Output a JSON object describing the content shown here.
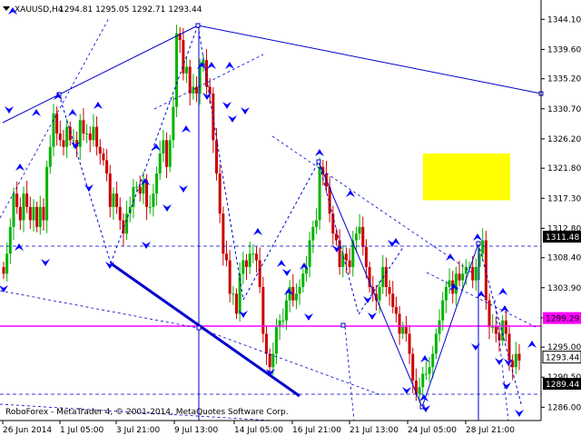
{
  "header": {
    "symbol": "XAUUSD,H4",
    "ohlc": "1294.81 1295.05 1292.71 1293.44"
  },
  "watermark": "RoboForex - MetaTrader 4, © 2001-2014, MetaQuotes Software Corp.",
  "colors": {
    "bull": "#00b400",
    "bear": "#cc0000",
    "trend": "#0000cc",
    "magenta": "#ff00ff",
    "zone": "#ffff00",
    "arrow": "#0000ff"
  },
  "icons": [
    "down-triangle-icon"
  ],
  "price_tags": [
    {
      "text": "1311.48",
      "price": 1311.48,
      "style": "dark"
    },
    {
      "text": "1299.29",
      "price": 1299.29,
      "style": "magenta"
    },
    {
      "text": "1293.44",
      "price": 1293.44,
      "style": "light"
    },
    {
      "text": "1289.44",
      "price": 1289.44,
      "style": "dark"
    }
  ],
  "chart_data": {
    "type": "candlestick",
    "symbol": "XAUUSD",
    "timeframe": "H4",
    "y_ticks": [
      "1344.10",
      "1339.60",
      "1335.20",
      "1330.70",
      "1326.20",
      "1321.80",
      "1317.30",
      "1312.80",
      "1308.40",
      "1303.90",
      "1299.40",
      "1295.00",
      "1290.50",
      "1286.00"
    ],
    "y_values": [
      1344.1,
      1339.6,
      1335.2,
      1330.7,
      1326.2,
      1321.8,
      1317.3,
      1312.8,
      1308.4,
      1303.9,
      1299.4,
      1295.0,
      1290.5,
      1286.0
    ],
    "x_ticks": [
      "26 Jun 2014",
      "1 Jul 05:00",
      "3 Jul 21:00",
      "9 Jul 13:00",
      "14 Jul 05:00",
      "16 Jul 21:00",
      "21 Jul 13:00",
      "24 Jul 05:00",
      "28 Jul 21:00"
    ],
    "ylim": [
      1284.0,
      1347.0
    ],
    "horizontal_levels": [
      1311.48,
      1299.29,
      1289.44
    ],
    "target_zone": [
      1317.0,
      1324.0
    ],
    "last_close": 1293.44,
    "close_path": [
      1306,
      1309,
      1313,
      1318,
      1316,
      1314,
      1318,
      1316,
      1314,
      1316,
      1313,
      1316,
      1314,
      1322,
      1325,
      1330,
      1327,
      1326,
      1325,
      1328,
      1326,
      1326,
      1325,
      1329,
      1327,
      1327,
      1326,
      1328,
      1325,
      1324,
      1323,
      1321,
      1316,
      1318,
      1316,
      1314,
      1312,
      1315,
      1316,
      1319,
      1319,
      1318,
      1320,
      1316,
      1316,
      1318,
      1321,
      1324,
      1326,
      1322,
      1326,
      1331,
      1342,
      1341,
      1336,
      1337,
      1333,
      1334,
      1333,
      1337,
      1338,
      1334,
      1333,
      1326,
      1321,
      1315,
      1309,
      1308,
      1303,
      1303,
      1300,
      1306,
      1308,
      1307,
      1309,
      1309,
      1308,
      1304,
      1297,
      1294,
      1292,
      1294,
      1298,
      1299,
      1299,
      1302,
      1304,
      1302,
      1303,
      1304,
      1306,
      1307,
      1311,
      1313,
      1314,
      1322,
      1321,
      1319,
      1315,
      1312,
      1311,
      1307,
      1309,
      1308,
      1307,
      1311,
      1312,
      1313,
      1310,
      1307,
      1304,
      1303,
      1302,
      1304,
      1307,
      1304,
      1303,
      1301,
      1300,
      1297,
      1298,
      1297,
      1294,
      1290,
      1288,
      1289,
      1291,
      1291,
      1292,
      1294,
      1297,
      1299,
      1302,
      1304,
      1305,
      1303,
      1306,
      1305,
      1306,
      1307,
      1307,
      1305,
      1307,
      1309,
      1311,
      1302,
      1298,
      1298,
      1297,
      1296,
      1299,
      1297,
      1293,
      1292,
      1294,
      1293
    ]
  }
}
